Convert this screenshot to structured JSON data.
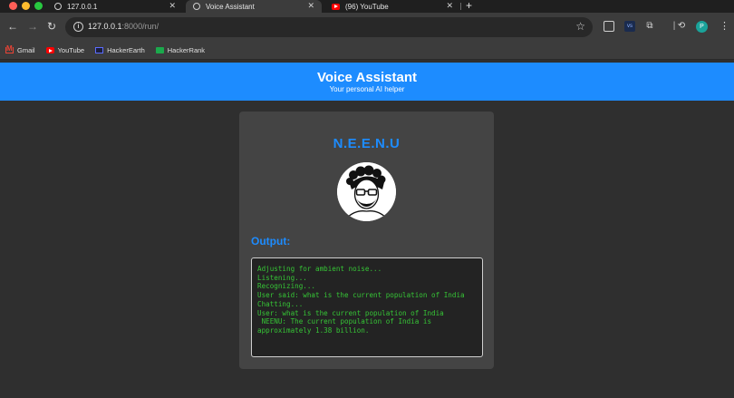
{
  "browser": {
    "tabs": [
      {
        "label": "127.0.0.1",
        "icon": "globe-icon",
        "active": false
      },
      {
        "label": "Voice Assistant",
        "icon": "globe-icon",
        "active": true
      },
      {
        "label": "(96) YouTube",
        "icon": "youtube-icon",
        "active": false
      }
    ],
    "url_host": "127.0.0.1",
    "url_rest": ":8000/run/",
    "profile_initial": "P",
    "bookmarks": [
      {
        "label": "Gmail",
        "icon": "gmail-icon"
      },
      {
        "label": "YouTube",
        "icon": "youtube-icon"
      },
      {
        "label": "HackerEarth",
        "icon": "hackerearth-icon"
      },
      {
        "label": "HackerRank",
        "icon": "hackerrank-icon"
      }
    ]
  },
  "header": {
    "title": "Voice Assistant",
    "subtitle": "Your personal AI helper",
    "color": "#1d8cff"
  },
  "card": {
    "name": "N.E.E.N.U",
    "output_label": "Output:",
    "output_lines": [
      "Adjusting for ambient noise...",
      "Listening...",
      "Recognizing...",
      "User said: what is the current population of India",
      "Chatting...",
      "User: what is the current population of India",
      " NEENU: The current population of India is approximately 1.38 billion."
    ],
    "output_color": "#36c536"
  }
}
